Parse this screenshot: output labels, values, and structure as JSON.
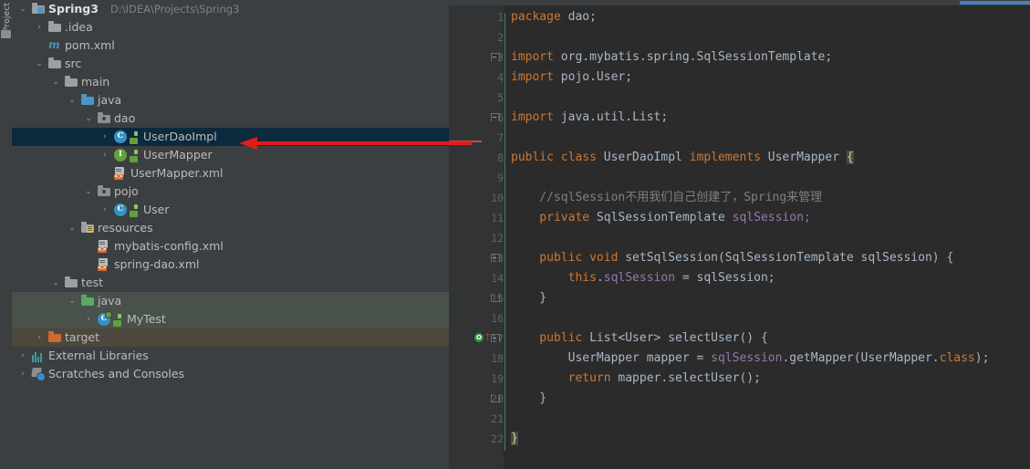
{
  "toolwindow": {
    "label": "Project"
  },
  "tree": {
    "rows": [
      {
        "id": "spring3",
        "label": "Spring3",
        "sub": "D:\\IDEA\\Projects\\Spring3",
        "icon": "module-folder-icon",
        "arrow": "⌄",
        "indent": 22,
        "bold": true,
        "state": "expanded"
      },
      {
        "id": "idea",
        "label": ".idea",
        "sub": "",
        "icon": "folder-icon",
        "arrow": "›",
        "indent": 40,
        "bold": false,
        "state": "collapsed"
      },
      {
        "id": "pomxml",
        "label": "pom.xml",
        "sub": "",
        "icon": "maven-m-icon",
        "arrow": "",
        "indent": 40,
        "bold": false,
        "state": "leaf"
      },
      {
        "id": "src",
        "label": "src",
        "sub": "",
        "icon": "folder-icon",
        "arrow": "⌄",
        "indent": 40,
        "bold": false,
        "state": "expanded"
      },
      {
        "id": "main",
        "label": "main",
        "sub": "",
        "icon": "folder-icon",
        "arrow": "⌄",
        "indent": 58,
        "bold": false,
        "state": "expanded"
      },
      {
        "id": "java",
        "label": "java",
        "sub": "",
        "icon": "source-folder-icon",
        "arrow": "⌄",
        "indent": 76,
        "bold": false,
        "state": "expanded"
      },
      {
        "id": "dao",
        "label": "dao",
        "sub": "",
        "icon": "package-icon",
        "arrow": "⌄",
        "indent": 94,
        "bold": false,
        "state": "expanded"
      },
      {
        "id": "userdaoimpl",
        "label": "UserDaoImpl",
        "sub": "",
        "icon": "java-class-icon",
        "arrow": "›",
        "indent": 112,
        "bold": false,
        "state": "collapsed"
      },
      {
        "id": "usermapper",
        "label": "UserMapper",
        "sub": "",
        "icon": "java-interface-icon",
        "arrow": "›",
        "indent": 112,
        "bold": false,
        "state": "collapsed"
      },
      {
        "id": "usermapperxml",
        "label": "UserMapper.xml",
        "sub": "",
        "icon": "xml-file-icon",
        "arrow": "",
        "indent": 112,
        "bold": false,
        "state": "leaf"
      },
      {
        "id": "pojo",
        "label": "pojo",
        "sub": "",
        "icon": "package-icon",
        "arrow": "⌄",
        "indent": 94,
        "bold": false,
        "state": "expanded"
      },
      {
        "id": "user",
        "label": "User",
        "sub": "",
        "icon": "java-class-icon",
        "arrow": "›",
        "indent": 112,
        "bold": false,
        "state": "collapsed"
      },
      {
        "id": "resources",
        "label": "resources",
        "sub": "",
        "icon": "resources-folder-icon",
        "arrow": "⌄",
        "indent": 76,
        "bold": false,
        "state": "expanded"
      },
      {
        "id": "mybatisconfig",
        "label": "mybatis-config.xml",
        "sub": "",
        "icon": "xml-file-icon",
        "arrow": "",
        "indent": 94,
        "bold": false,
        "state": "leaf"
      },
      {
        "id": "springdao",
        "label": "spring-dao.xml",
        "sub": "",
        "icon": "xml-file-icon",
        "arrow": "",
        "indent": 94,
        "bold": false,
        "state": "leaf"
      },
      {
        "id": "test",
        "label": "test",
        "sub": "",
        "icon": "folder-icon",
        "arrow": "⌄",
        "indent": 58,
        "bold": false,
        "state": "expanded"
      },
      {
        "id": "testjava",
        "label": "java",
        "sub": "",
        "icon": "test-source-folder-icon",
        "arrow": "⌄",
        "indent": 76,
        "bold": false,
        "state": "expanded"
      },
      {
        "id": "mytest",
        "label": "MyTest",
        "sub": "",
        "icon": "java-test-class-icon",
        "arrow": "›",
        "indent": 94,
        "bold": false,
        "state": "collapsed"
      },
      {
        "id": "target",
        "label": "target",
        "sub": "",
        "icon": "excluded-folder-icon",
        "arrow": "›",
        "indent": 40,
        "bold": false,
        "state": "collapsed"
      },
      {
        "id": "extlibs",
        "label": "External Libraries",
        "sub": "",
        "icon": "external-libraries-icon",
        "arrow": "›",
        "indent": 22,
        "bold": false,
        "state": "collapsed"
      },
      {
        "id": "scratches",
        "label": "Scratches and Consoles",
        "sub": "",
        "icon": "scratches-icon",
        "arrow": "›",
        "indent": 22,
        "bold": false,
        "state": "collapsed"
      }
    ],
    "selected_row_id": "userdaoimpl"
  },
  "editor": {
    "lines": [
      {
        "num": "1",
        "fold": "",
        "tokens": [
          {
            "t": "package ",
            "c": "k"
          },
          {
            "t": "dao;",
            "c": "t"
          }
        ]
      },
      {
        "num": "2",
        "fold": "",
        "tokens": []
      },
      {
        "num": "3",
        "fold": "open",
        "tokens": [
          {
            "t": "import ",
            "c": "k"
          },
          {
            "t": "org.mybatis.spring.SqlSessionTemplate;",
            "c": "t"
          }
        ]
      },
      {
        "num": "4",
        "fold": "",
        "tokens": [
          {
            "t": "import ",
            "c": "k"
          },
          {
            "t": "pojo.User;",
            "c": "t"
          }
        ]
      },
      {
        "num": "5",
        "fold": "",
        "tokens": []
      },
      {
        "num": "6",
        "fold": "open",
        "tokens": [
          {
            "t": "import ",
            "c": "k"
          },
          {
            "t": "java.util.List;",
            "c": "t"
          }
        ]
      },
      {
        "num": "7",
        "fold": "",
        "tokens": []
      },
      {
        "num": "8",
        "fold": "",
        "tokens": [
          {
            "t": "public class ",
            "c": "k"
          },
          {
            "t": "UserDaoImpl ",
            "c": "cn"
          },
          {
            "t": "implements ",
            "c": "k"
          },
          {
            "t": "UserMapper ",
            "c": "cn"
          },
          {
            "t": "{",
            "c": "brace-hl"
          }
        ]
      },
      {
        "num": "9",
        "fold": "",
        "tokens": []
      },
      {
        "num": "10",
        "fold": "",
        "tokens": [
          {
            "t": "    //sqlSession不用我们自己创建了，Spring来管理",
            "c": "cm"
          }
        ]
      },
      {
        "num": "11",
        "fold": "",
        "tokens": [
          {
            "t": "    private ",
            "c": "k"
          },
          {
            "t": "SqlSessionTemplate ",
            "c": "t"
          },
          {
            "t": "sqlSession;",
            "c": "fld"
          }
        ]
      },
      {
        "num": "12",
        "fold": "",
        "tokens": []
      },
      {
        "num": "13",
        "fold": "open",
        "tokens": [
          {
            "t": "    public void ",
            "c": "k"
          },
          {
            "t": "setSqlSession",
            "c": "t"
          },
          {
            "t": "(SqlSessionTemplate sqlSession) {",
            "c": "t"
          }
        ]
      },
      {
        "num": "14",
        "fold": "",
        "tokens": [
          {
            "t": "        this",
            "c": "k"
          },
          {
            "t": ".",
            "c": "t"
          },
          {
            "t": "sqlSession",
            "c": "fld"
          },
          {
            "t": " = sqlSession;",
            "c": "t"
          }
        ]
      },
      {
        "num": "15",
        "fold": "close",
        "tokens": [
          {
            "t": "    }",
            "c": "t"
          }
        ]
      },
      {
        "num": "16",
        "fold": "",
        "tokens": []
      },
      {
        "num": "17",
        "fold": "open",
        "impl": true,
        "tokens": [
          {
            "t": "    public ",
            "c": "k"
          },
          {
            "t": "List<User> ",
            "c": "t"
          },
          {
            "t": "selectUser",
            "c": "t"
          },
          {
            "t": "() {",
            "c": "t"
          }
        ]
      },
      {
        "num": "18",
        "fold": "",
        "tokens": [
          {
            "t": "        UserMapper mapper = ",
            "c": "t"
          },
          {
            "t": "sqlSession",
            "c": "fld"
          },
          {
            "t": ".getMapper(UserMapper.",
            "c": "t"
          },
          {
            "t": "class",
            "c": "k"
          },
          {
            "t": ");",
            "c": "t"
          }
        ]
      },
      {
        "num": "19",
        "fold": "",
        "tokens": [
          {
            "t": "        return ",
            "c": "k"
          },
          {
            "t": "mapper.selectUser();",
            "c": "t"
          }
        ]
      },
      {
        "num": "20",
        "fold": "close",
        "tokens": [
          {
            "t": "    }",
            "c": "t"
          }
        ]
      },
      {
        "num": "21",
        "fold": "",
        "tokens": []
      },
      {
        "num": "22",
        "fold": "",
        "tokens": [
          {
            "t": "}",
            "c": "brace-hl"
          }
        ]
      }
    ],
    "caret_line": "7",
    "impl_gutter_glyph": "O"
  },
  "annotation": {
    "type": "red-arrow",
    "color": "#e01b1b",
    "points_to": "UserDaoImpl"
  }
}
